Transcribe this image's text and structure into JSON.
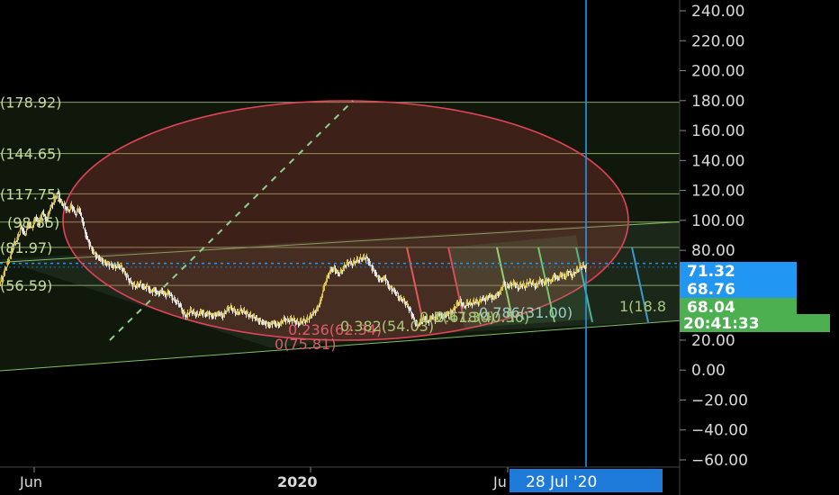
{
  "chart_data": {
    "type": "candlestick",
    "y_axis": {
      "ticks": [
        "240.00",
        "220.00",
        "200.00",
        "180.00",
        "160.00",
        "140.00",
        "120.00",
        "100.00",
        "80.00",
        "60.00",
        "40.00",
        "20.00",
        "0.00",
        "−20.00",
        "−40.00",
        "−60.00"
      ],
      "values": [
        240,
        220,
        200,
        180,
        160,
        140,
        120,
        100,
        80,
        60,
        40,
        20,
        0,
        -20,
        -40,
        -60
      ],
      "range": [
        -65,
        248
      ]
    },
    "x_axis": {
      "labels": [
        {
          "text": "Jun",
          "bold": false
        },
        {
          "text": "2020",
          "bold": true
        },
        {
          "text": "Ju",
          "bold": false
        }
      ]
    },
    "crosshair_date": "28 Jul '20",
    "price_badges": [
      {
        "text": "71.32",
        "value": 71.32,
        "color": "#2196f3"
      },
      {
        "text": "68.76",
        "value": 68.76,
        "color": "#2196f3"
      },
      {
        "text": "68.04",
        "value": 68.04,
        "color": "#4caf50"
      },
      {
        "text": "20:41:33",
        "value": null,
        "color": "#4caf50"
      }
    ],
    "fib_levels": [
      {
        "text": "(178.92)",
        "value": 178.92
      },
      {
        "text": "(144.65)",
        "value": 144.65
      },
      {
        "text": "(117.75)",
        "value": 117.75
      },
      {
        "text": "(98.85)",
        "value": 98.85
      },
      {
        "text": "(81.97)",
        "value": 81.97
      },
      {
        "text": "(56.59)",
        "value": 56.59
      }
    ],
    "fib_time_labels": [
      {
        "text": "0(75.81)"
      },
      {
        "text": "0.236(62.34)"
      },
      {
        "text": "0.382(54.03)"
      },
      {
        "text": "0.5(47.30)"
      },
      {
        "text": "0.618(40.56)"
      },
      {
        "text": "0.786(31.00)"
      },
      {
        "text": "1(18.8"
      }
    ],
    "price_path": [
      [
        0,
        58
      ],
      [
        4,
        63
      ],
      [
        8,
        70
      ],
      [
        12,
        76
      ],
      [
        16,
        84
      ],
      [
        20,
        88
      ],
      [
        24,
        96
      ],
      [
        28,
        90
      ],
      [
        32,
        98
      ],
      [
        36,
        95
      ],
      [
        40,
        102
      ],
      [
        44,
        98
      ],
      [
        48,
        106
      ],
      [
        52,
        99
      ],
      [
        56,
        108
      ],
      [
        60,
        112
      ],
      [
        64,
        118
      ],
      [
        68,
        112
      ],
      [
        72,
        110
      ],
      [
        76,
        106
      ],
      [
        80,
        110
      ],
      [
        84,
        104
      ],
      [
        88,
        108
      ],
      [
        92,
        100
      ],
      [
        96,
        90
      ],
      [
        100,
        84
      ],
      [
        104,
        79
      ],
      [
        108,
        76
      ],
      [
        112,
        74
      ],
      [
        116,
        72
      ],
      [
        120,
        71
      ],
      [
        124,
        70
      ],
      [
        128,
        69
      ],
      [
        132,
        70
      ],
      [
        136,
        68
      ],
      [
        140,
        64
      ],
      [
        144,
        60
      ],
      [
        148,
        57
      ],
      [
        152,
        56
      ],
      [
        156,
        58
      ],
      [
        160,
        55
      ],
      [
        164,
        56
      ],
      [
        168,
        52
      ],
      [
        172,
        54
      ],
      [
        176,
        51
      ],
      [
        180,
        53
      ],
      [
        184,
        50
      ],
      [
        188,
        52
      ],
      [
        192,
        48
      ],
      [
        196,
        46
      ],
      [
        200,
        44
      ],
      [
        204,
        38
      ],
      [
        208,
        36
      ],
      [
        212,
        40
      ],
      [
        216,
        38
      ],
      [
        220,
        37
      ],
      [
        224,
        39
      ],
      [
        228,
        37
      ],
      [
        232,
        38
      ],
      [
        236,
        36
      ],
      [
        240,
        37
      ],
      [
        244,
        38
      ],
      [
        248,
        36
      ],
      [
        252,
        40
      ],
      [
        256,
        42
      ],
      [
        260,
        40
      ],
      [
        264,
        38
      ],
      [
        268,
        40
      ],
      [
        272,
        39
      ],
      [
        276,
        37
      ],
      [
        280,
        36
      ],
      [
        284,
        35
      ],
      [
        288,
        33
      ],
      [
        292,
        32
      ],
      [
        296,
        31
      ],
      [
        300,
        30
      ],
      [
        304,
        32
      ],
      [
        308,
        30
      ],
      [
        312,
        31
      ],
      [
        316,
        34
      ],
      [
        320,
        33
      ],
      [
        324,
        34
      ],
      [
        328,
        33
      ],
      [
        332,
        31
      ],
      [
        336,
        33
      ],
      [
        340,
        33
      ],
      [
        344,
        35
      ],
      [
        348,
        38
      ],
      [
        352,
        40
      ],
      [
        356,
        45
      ],
      [
        360,
        55
      ],
      [
        364,
        62
      ],
      [
        368,
        67
      ],
      [
        372,
        68
      ],
      [
        376,
        64
      ],
      [
        380,
        66
      ],
      [
        384,
        70
      ],
      [
        388,
        72
      ],
      [
        392,
        71
      ],
      [
        396,
        73
      ],
      [
        400,
        74
      ],
      [
        404,
        75
      ],
      [
        408,
        75
      ],
      [
        412,
        70
      ],
      [
        416,
        66
      ],
      [
        420,
        62
      ],
      [
        424,
        60
      ],
      [
        428,
        62
      ],
      [
        432,
        56
      ],
      [
        436,
        54
      ],
      [
        440,
        52
      ],
      [
        444,
        48
      ],
      [
        448,
        47
      ],
      [
        452,
        44
      ],
      [
        456,
        40
      ],
      [
        460,
        34
      ],
      [
        464,
        30
      ],
      [
        468,
        32
      ],
      [
        472,
        35
      ],
      [
        476,
        32
      ],
      [
        480,
        36
      ],
      [
        484,
        34
      ],
      [
        488,
        38
      ],
      [
        492,
        36
      ],
      [
        496,
        37
      ],
      [
        500,
        38
      ],
      [
        504,
        40
      ],
      [
        508,
        44
      ],
      [
        512,
        46
      ],
      [
        516,
        42
      ],
      [
        520,
        45
      ],
      [
        524,
        44
      ],
      [
        528,
        46
      ],
      [
        532,
        45
      ],
      [
        536,
        48
      ],
      [
        540,
        47
      ],
      [
        544,
        50
      ],
      [
        548,
        48
      ],
      [
        552,
        50
      ],
      [
        556,
        52
      ],
      [
        560,
        58
      ],
      [
        564,
        56
      ],
      [
        568,
        57
      ],
      [
        572,
        58
      ],
      [
        576,
        55
      ],
      [
        580,
        57
      ],
      [
        584,
        56
      ],
      [
        588,
        59
      ],
      [
        592,
        58
      ],
      [
        596,
        56
      ],
      [
        600,
        60
      ],
      [
        604,
        58
      ],
      [
        608,
        60
      ],
      [
        612,
        59
      ],
      [
        616,
        63
      ],
      [
        620,
        61
      ],
      [
        624,
        64
      ],
      [
        628,
        62
      ],
      [
        632,
        66
      ],
      [
        636,
        63
      ],
      [
        640,
        66
      ],
      [
        644,
        68
      ],
      [
        648,
        70
      ],
      [
        652,
        68.04
      ]
    ]
  }
}
